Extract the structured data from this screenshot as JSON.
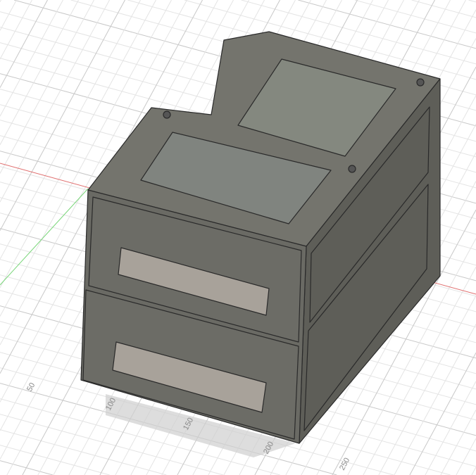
{
  "viewport": {
    "grid_labels": [
      "50",
      "100",
      "150",
      "200",
      "250"
    ],
    "colors": {
      "body": "#6d6d66",
      "top": "#7a7a73",
      "side": "#5f5f59",
      "handle": "#a8a29a",
      "x_axis": "#e06060",
      "y_axis": "#6ad36a",
      "grid": "#d8d8d8"
    }
  }
}
